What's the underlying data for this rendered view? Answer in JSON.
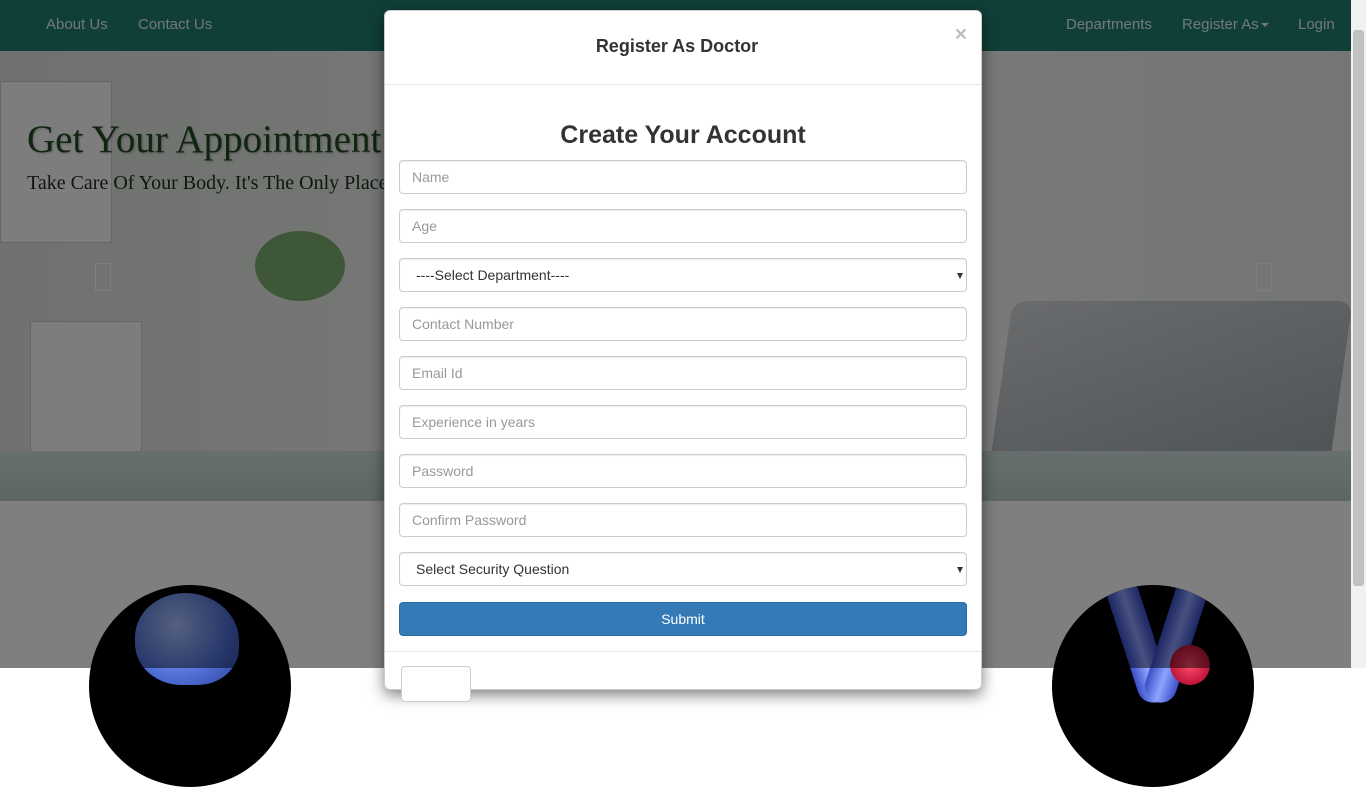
{
  "nav": {
    "left_links": [
      "About Us",
      "Contact Us"
    ],
    "right_links": [
      "Departments",
      "Register As",
      "Login"
    ]
  },
  "hero": {
    "title": "Get Your Appointment",
    "subtitle": "Take Care Of Your Body. It's The Only Place"
  },
  "modal": {
    "title": "Register As Doctor",
    "close_symbol": "×",
    "form_title": "Create Your Account",
    "fields": {
      "name_placeholder": "Name",
      "age_placeholder": "Age",
      "department_selected": "----Select Department----",
      "contact_placeholder": "Contact Number",
      "email_placeholder": "Email Id",
      "experience_placeholder": "Experience in years",
      "password_placeholder": "Password",
      "confirm_password_placeholder": "Confirm Password",
      "security_question_selected": "Select Security Question"
    },
    "submit_label": "Submit"
  },
  "colors": {
    "navbar": "#1e7e70",
    "primary_button": "#337ab7"
  }
}
